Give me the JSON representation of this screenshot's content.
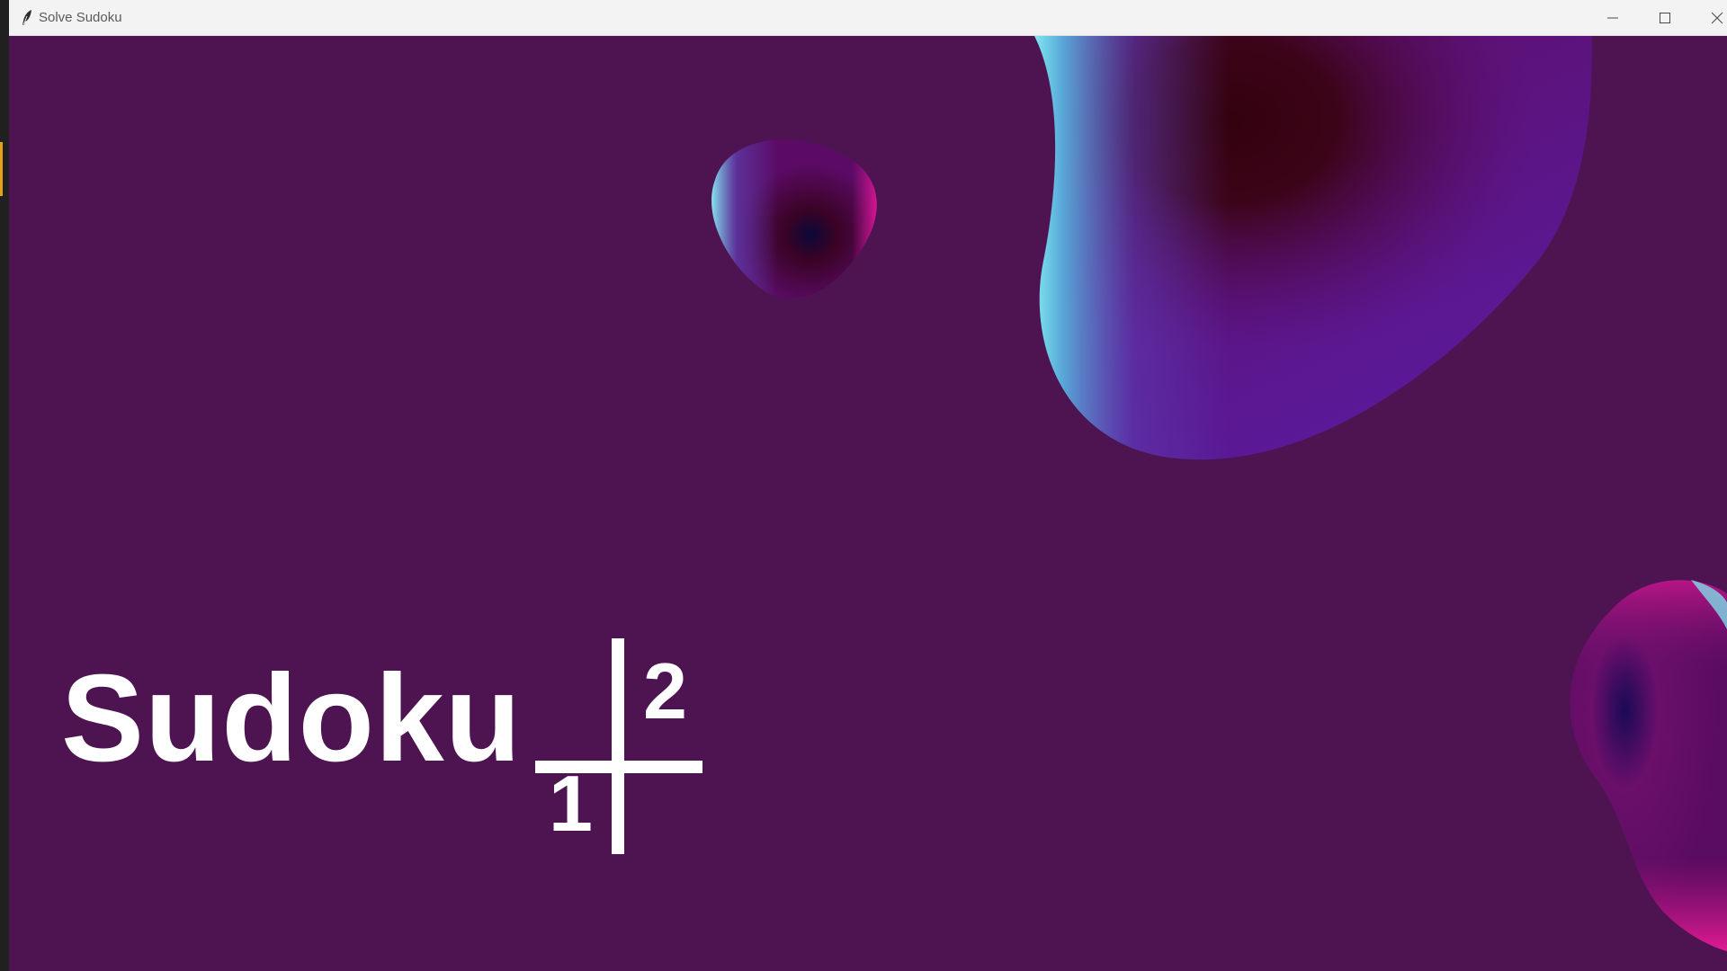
{
  "window": {
    "title": "Solve Sudoku",
    "icon": "feather-icon",
    "controls": {
      "minimize": "minimize-icon",
      "maximize": "maximize-icon",
      "close": "close-icon"
    }
  },
  "splash": {
    "logo_text": "Sudoku",
    "mark_digit_top": "2",
    "mark_digit_bottom": "1"
  },
  "colors": {
    "background": "#4e1452",
    "logo": "#ffffff",
    "titlebar": "#f3f3f3"
  }
}
